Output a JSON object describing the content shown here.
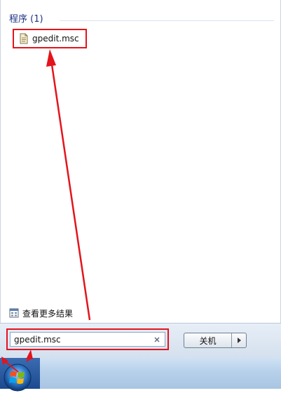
{
  "start_menu": {
    "programs_header": "程序 (1)",
    "result_item": {
      "label": "gpedit.msc",
      "icon": "document-icon"
    },
    "see_more_label": "查看更多结果",
    "search": {
      "value": "gpedit.msc",
      "clear_icon": "close-icon"
    },
    "shutdown": {
      "label": "关机",
      "arrow_icon": "triangle-right-icon"
    }
  },
  "taskbar": {
    "start_icon": "windows-orb-icon"
  },
  "colors": {
    "annotation_red": "#e3141c",
    "header_blue": "#1e3287",
    "start_blue": "#2a5aa4"
  }
}
